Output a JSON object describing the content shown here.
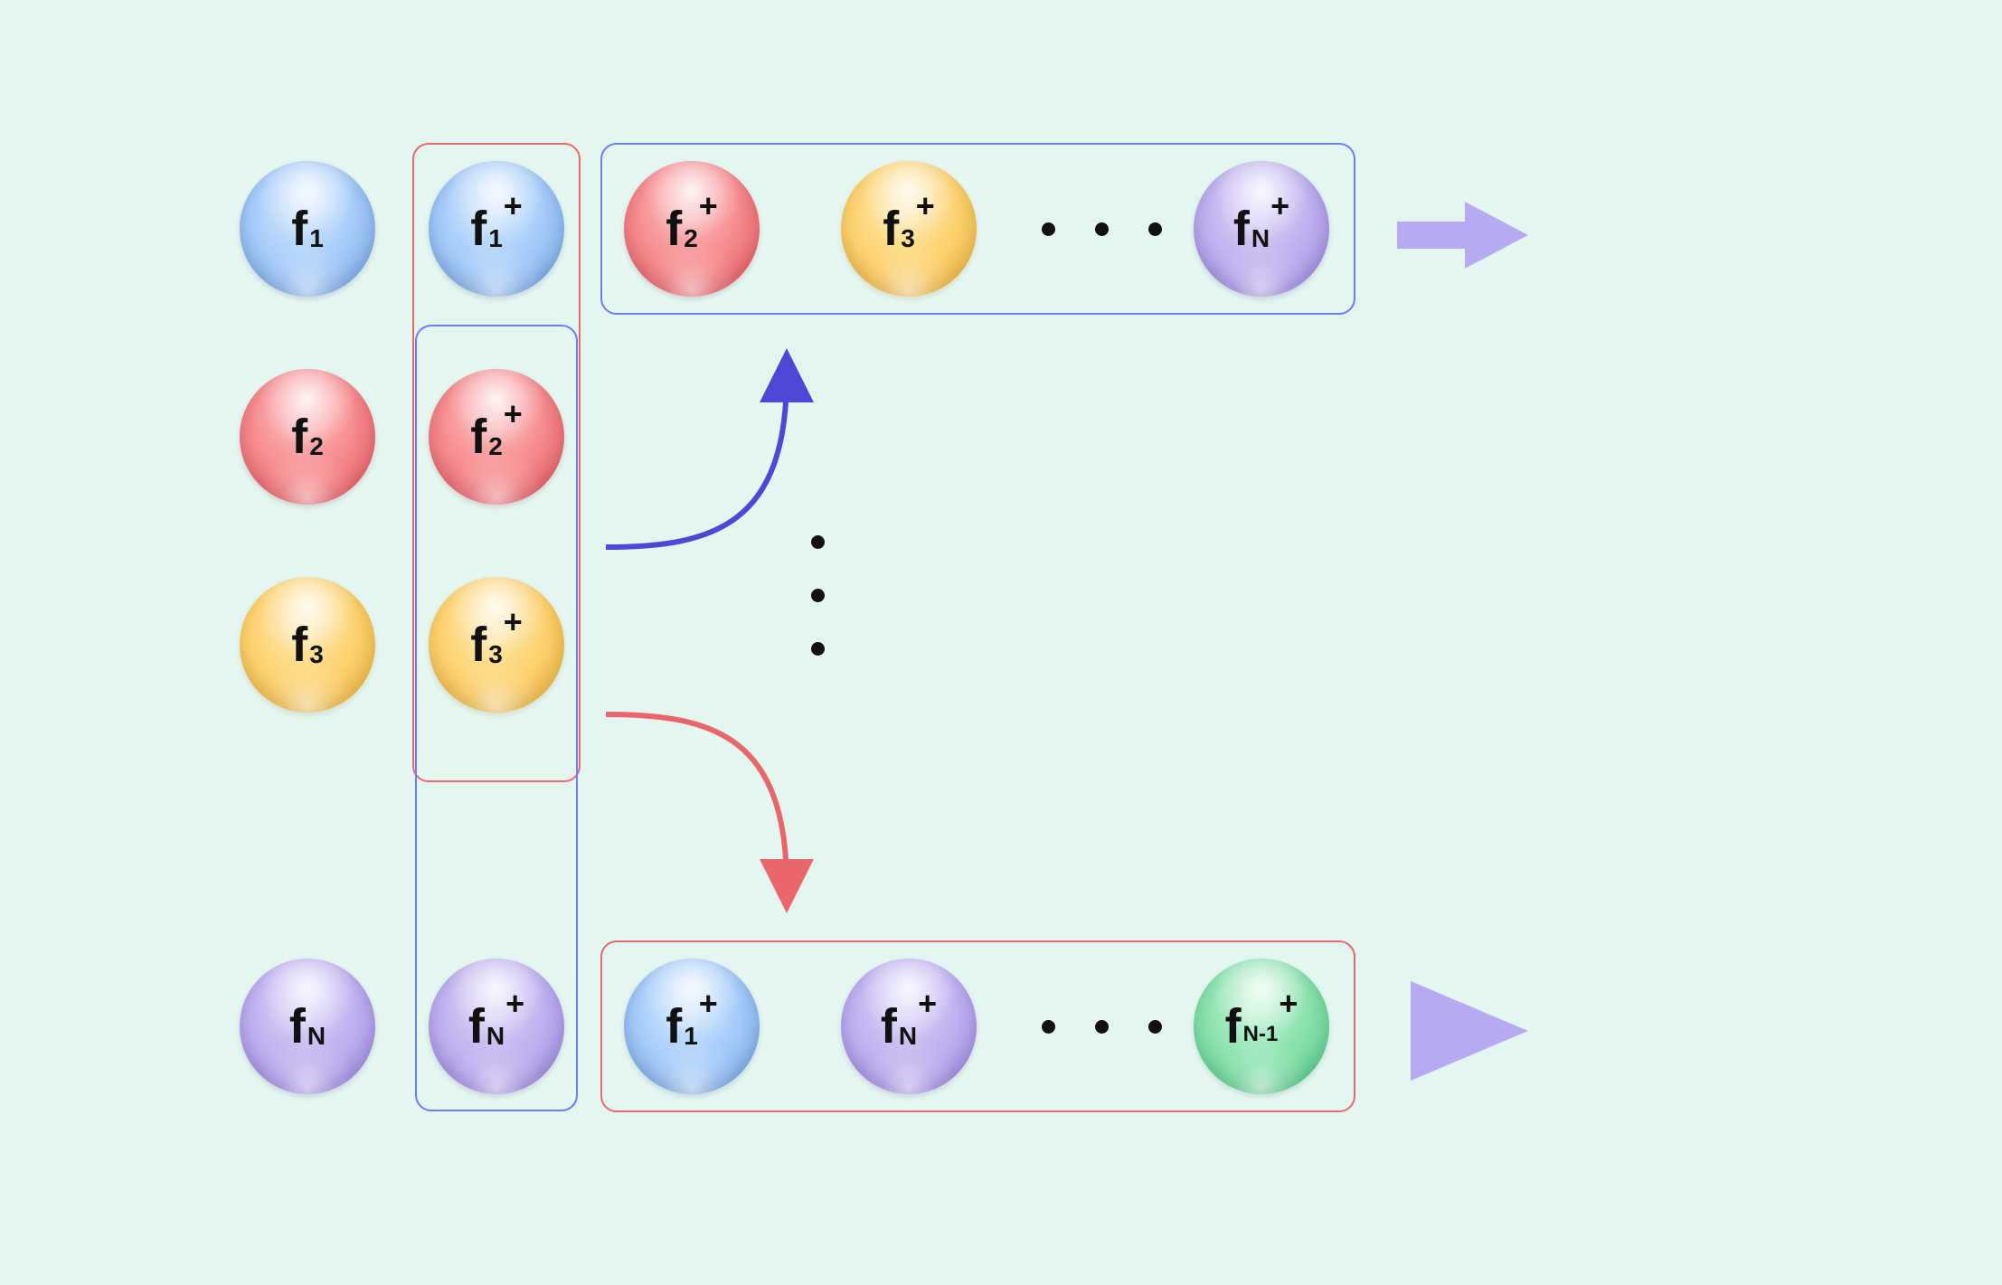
{
  "diagram": {
    "columnA": [
      {
        "id": "f1",
        "base": "f",
        "sub": "1",
        "color": "blue"
      },
      {
        "id": "f2",
        "base": "f",
        "sub": "2",
        "color": "red"
      },
      {
        "id": "f3",
        "base": "f",
        "sub": "3",
        "color": "yellow"
      },
      {
        "id": "fN",
        "base": "f",
        "sub": "N",
        "color": "purple"
      }
    ],
    "columnB": [
      {
        "id": "f1p",
        "base": "f",
        "sub": "1",
        "sup": "+",
        "color": "blue"
      },
      {
        "id": "f2p",
        "base": "f",
        "sub": "2",
        "sup": "+",
        "color": "red"
      },
      {
        "id": "f3p",
        "base": "f",
        "sub": "3",
        "sup": "+",
        "color": "yellow"
      },
      {
        "id": "fNp",
        "base": "f",
        "sub": "N",
        "sup": "+",
        "color": "purple"
      }
    ],
    "rowTop": [
      {
        "id": "t1",
        "base": "f",
        "sub": "2",
        "sup": "+",
        "color": "red"
      },
      {
        "id": "t2",
        "base": "f",
        "sub": "3",
        "sup": "+",
        "color": "yellow"
      },
      {
        "id": "t4",
        "base": "f",
        "sub": "N",
        "sup": "+",
        "color": "purple"
      }
    ],
    "rowBottom": [
      {
        "id": "b1",
        "base": "f",
        "sub": "1",
        "sup": "+",
        "color": "blue"
      },
      {
        "id": "b2",
        "base": "f",
        "sub": "N",
        "sup": "+",
        "color": "purple"
      },
      {
        "id": "b4",
        "base": "f",
        "sub": "N-1",
        "sup": "+",
        "color": "green"
      }
    ],
    "boxes": {
      "colB_red": {
        "color": "red"
      },
      "colB_blue": {
        "color": "blue"
      },
      "rowTop_blue": {
        "color": "blue"
      },
      "rowBottom_red": {
        "color": "red"
      }
    },
    "ellipsis": {
      "rowTop": "•••",
      "rowBottom": "•••",
      "center": "•••"
    },
    "arrows": {
      "rightTop": "arrow-right",
      "rightBottom": "triangle-right",
      "curveUp": "curve-up-blue",
      "curveDown": "curve-down-red"
    },
    "colors": {
      "blue": "#8fbdf2",
      "red": "#f07f85",
      "yellow": "#f6cd66",
      "purple": "#b4a4ea",
      "green": "#78dca4",
      "arrow": "#b8aaf0",
      "boxBlue": "#6f7af3",
      "boxRed": "#e9666d",
      "bg": "#e4f6f0"
    }
  }
}
